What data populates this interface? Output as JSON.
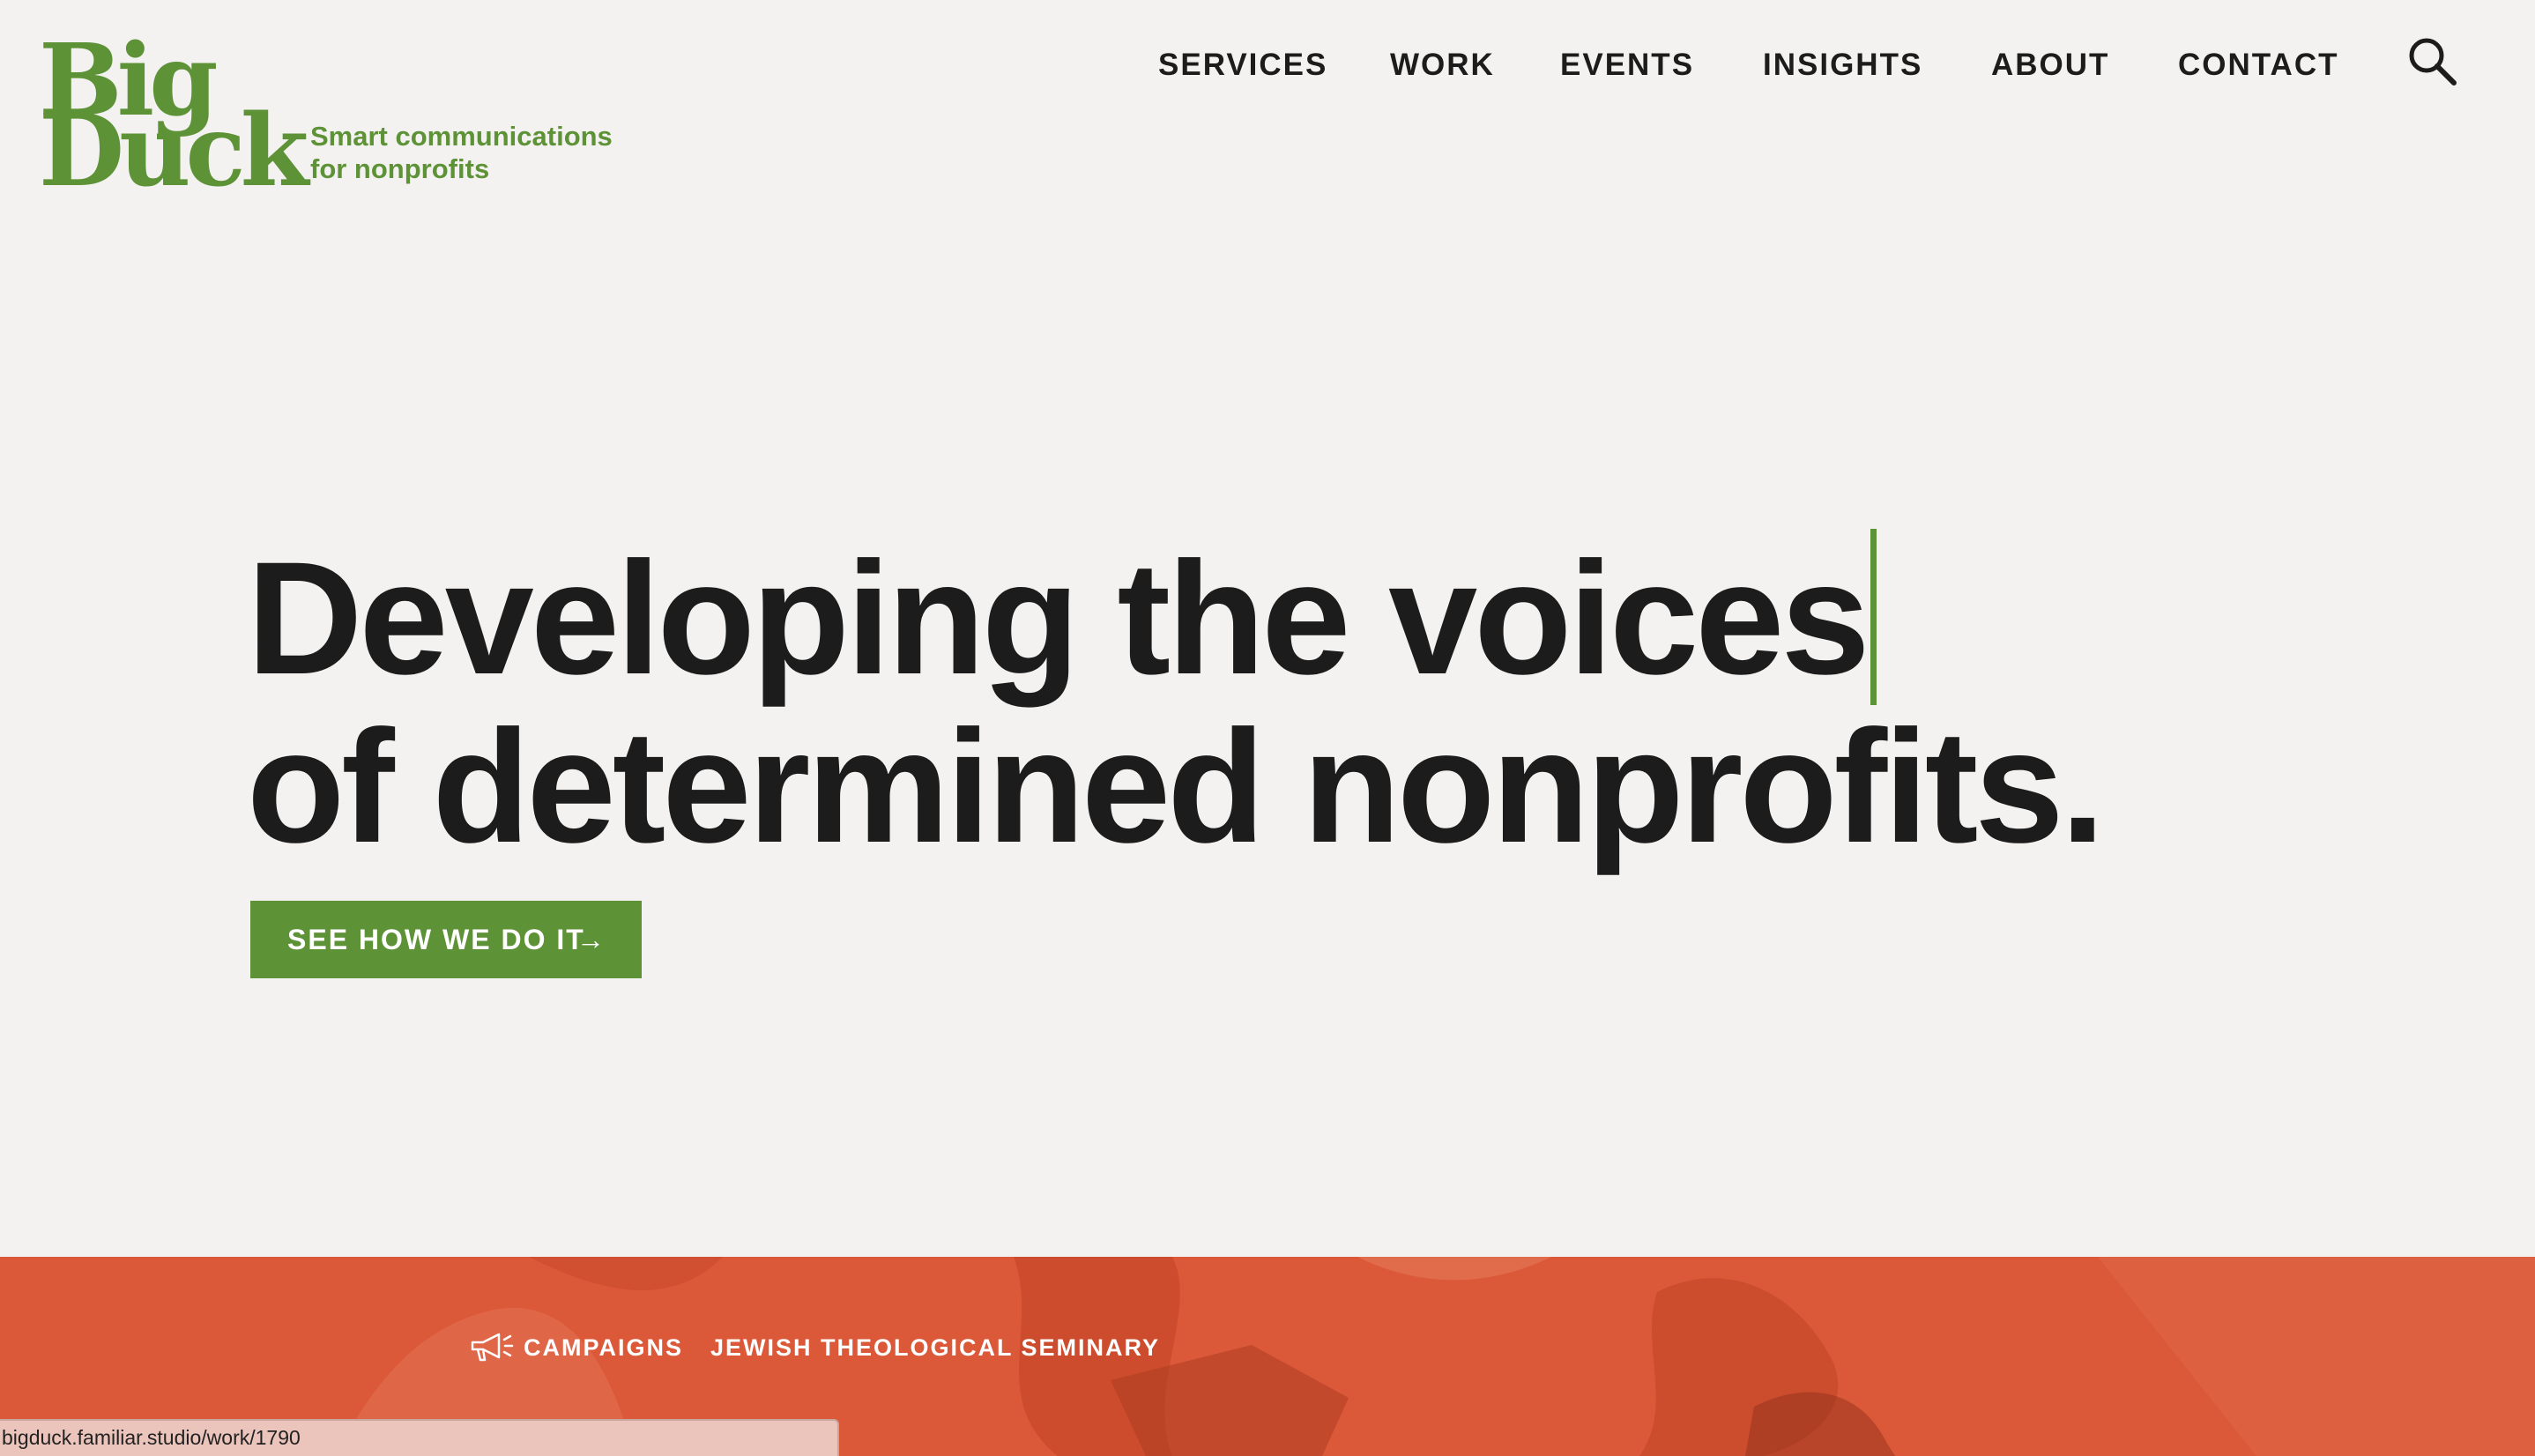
{
  "brand": {
    "logo_line1": "Big",
    "logo_line2": "Duck",
    "tagline_line1": "Smart communications",
    "tagline_line2": "for nonprofits",
    "color": "#5e9237"
  },
  "nav": {
    "items": [
      {
        "label": "SERVICES"
      },
      {
        "label": "WORK"
      },
      {
        "label": "EVENTS"
      },
      {
        "label": "INSIGHTS"
      },
      {
        "label": "ABOUT"
      },
      {
        "label": "CONTACT"
      }
    ],
    "search_icon": "search-icon"
  },
  "hero": {
    "headline_line1": "Developing the voices",
    "headline_line2": "of determined nonprofits.",
    "cta_label": "SEE HOW WE DO IT",
    "cta_arrow": "→",
    "cta_color": "#5e9237"
  },
  "featured": {
    "category_icon": "megaphone-icon",
    "category": "CAMPAIGNS",
    "client": "JEWISH THEOLOGICAL SEMINARY",
    "background_color": "#db5838"
  },
  "status_bar": {
    "url": "bigduck.familiar.studio/work/1790"
  }
}
